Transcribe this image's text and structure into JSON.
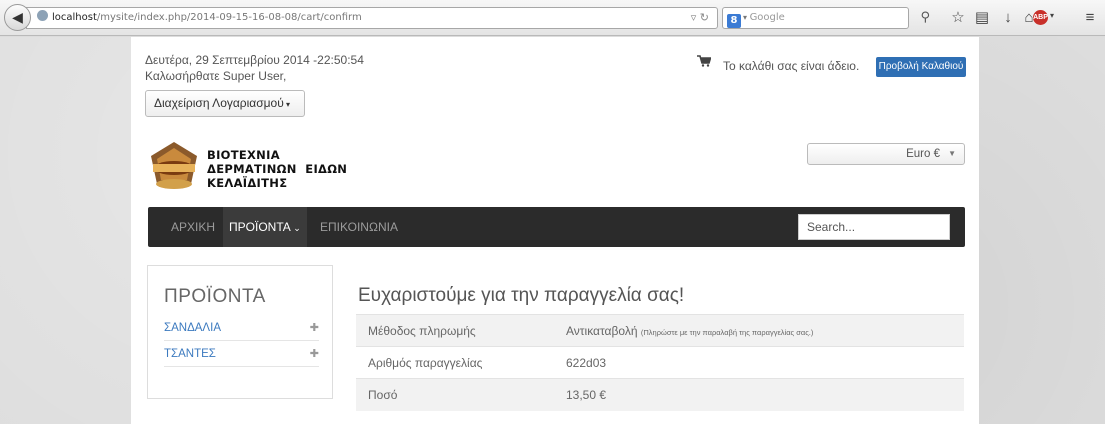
{
  "browser": {
    "url_host": "localhost",
    "url_path": "/mysite/index.php/2014-09-15-16-08-08/cart/confirm",
    "search_engine": "Google"
  },
  "header": {
    "date": "Δευτέρα, 29 Σεπτεμβρίου 2014 -22:50:54",
    "welcome": "Καλωσήρθατε Super User,",
    "account_button": "Διαχείριση Λογαριασμού",
    "cart_status": "Το καλάθι σας είναι άδειο.",
    "cart_button": "Προβολή Καλαθιού",
    "currency": "Euro €"
  },
  "logo": {
    "line1": "ΒΙΟΤΕΧΝΙΑ",
    "line2": "ΔΕΡΜΑΤΙΝΩΝ  ΕΙΔΩΝ",
    "line3": "ΚΕΛΑΪΔΙΤΗΣ"
  },
  "menu": {
    "items": [
      {
        "label": "ΑΡΧΙΚΗ"
      },
      {
        "label": "ΠΡΟΪΟΝΤΑ"
      },
      {
        "label": "ΕΠΙΚΟΙΝΩΝΙΑ"
      }
    ],
    "search_placeholder": "Search..."
  },
  "sidebar": {
    "title": "ΠΡΟΪΟΝΤΑ",
    "items": [
      {
        "label": "ΣΑΝΔΑΛΙΑ"
      },
      {
        "label": "ΤΣΑΝΤΕΣ"
      }
    ]
  },
  "confirmation": {
    "title": "Ευχαριστούμε για την παραγγελία σας!",
    "rows": [
      {
        "key": "Μέθοδος πληρωμής",
        "value": "Αντικαταβολή",
        "note": "(Πληρώστε με την παραλαβή της παραγγελίας σας.)"
      },
      {
        "key": "Αριθμός παραγγελίας",
        "value": "622d03"
      },
      {
        "key": "Ποσό",
        "value": "13,50 €"
      }
    ]
  },
  "colors": {
    "accent": "#2f6fb4",
    "menubar": "#2b2b2b",
    "link": "#3c7abf"
  }
}
